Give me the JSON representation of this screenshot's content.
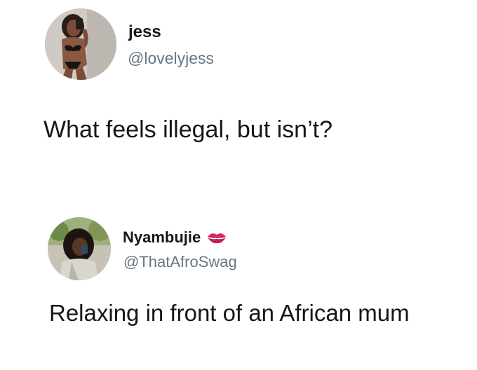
{
  "tweet_1": {
    "display_name": "jess",
    "handle": "@lovelyjess",
    "text": "What feels illegal, but isn’t?",
    "avatar_icon": "profile-photo"
  },
  "tweet_2": {
    "display_name": "Nyambujie",
    "handle": "@ThatAfroSwag",
    "text": "Relaxing in front of an African mum",
    "name_emoji": "kiss-mark-icon",
    "avatar_icon": "profile-photo"
  },
  "colors": {
    "text_primary": "#14171a",
    "text_secondary": "#657786",
    "kiss_mark": "#e0245e",
    "background": "#ffffff"
  }
}
